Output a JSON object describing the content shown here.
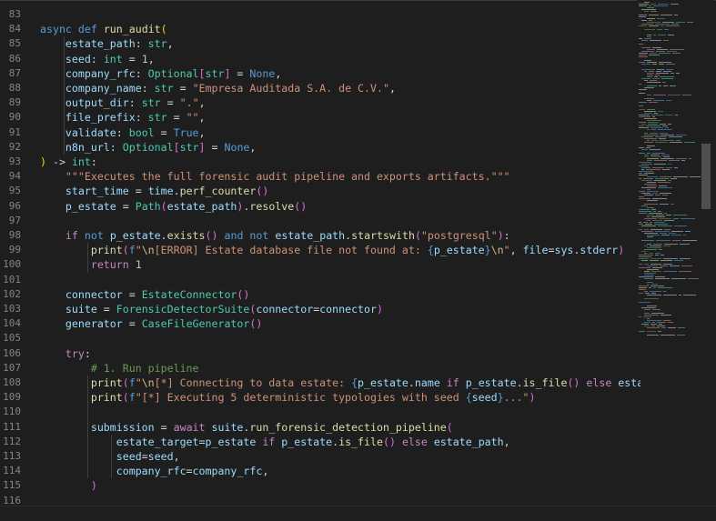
{
  "line_numbers": [
    "83",
    "84",
    "85",
    "86",
    "87",
    "88",
    "89",
    "90",
    "91",
    "92",
    "93",
    "94",
    "95",
    "96",
    "97",
    "98",
    "99",
    "100",
    "101",
    "102",
    "103",
    "104",
    "105",
    "106",
    "107",
    "108",
    "109",
    "110",
    "111",
    "112",
    "113",
    "114",
    "115",
    "116"
  ],
  "code": [
    [],
    [
      [
        "kw",
        "async"
      ],
      [
        "pn",
        " "
      ],
      [
        "kw",
        "def"
      ],
      [
        "pn",
        " "
      ],
      [
        "fn",
        "run_audit"
      ],
      [
        "par",
        "("
      ]
    ],
    [
      [
        "pn",
        "    "
      ],
      [
        "var",
        "estate_path"
      ],
      [
        "pn",
        ": "
      ],
      [
        "cls",
        "str"
      ],
      [
        "pn",
        ","
      ]
    ],
    [
      [
        "pn",
        "    "
      ],
      [
        "var",
        "seed"
      ],
      [
        "pn",
        ": "
      ],
      [
        "cls",
        "int"
      ],
      [
        "op",
        " = "
      ],
      [
        "num",
        "1"
      ],
      [
        "pn",
        ","
      ]
    ],
    [
      [
        "pn",
        "    "
      ],
      [
        "var",
        "company_rfc"
      ],
      [
        "pn",
        ": "
      ],
      [
        "cls",
        "Optional"
      ],
      [
        "br",
        "["
      ],
      [
        "cls",
        "str"
      ],
      [
        "br",
        "]"
      ],
      [
        "op",
        " = "
      ],
      [
        "kw",
        "None"
      ],
      [
        "pn",
        ","
      ]
    ],
    [
      [
        "pn",
        "    "
      ],
      [
        "var",
        "company_name"
      ],
      [
        "pn",
        ": "
      ],
      [
        "cls",
        "str"
      ],
      [
        "op",
        " = "
      ],
      [
        "str",
        "\"Empresa Auditada S.A. de C.V.\""
      ],
      [
        "pn",
        ","
      ]
    ],
    [
      [
        "pn",
        "    "
      ],
      [
        "var",
        "output_dir"
      ],
      [
        "pn",
        ": "
      ],
      [
        "cls",
        "str"
      ],
      [
        "op",
        " = "
      ],
      [
        "str",
        "\".\""
      ],
      [
        "pn",
        ","
      ]
    ],
    [
      [
        "pn",
        "    "
      ],
      [
        "var",
        "file_prefix"
      ],
      [
        "pn",
        ": "
      ],
      [
        "cls",
        "str"
      ],
      [
        "op",
        " = "
      ],
      [
        "str",
        "\"\""
      ],
      [
        "pn",
        ","
      ]
    ],
    [
      [
        "pn",
        "    "
      ],
      [
        "var",
        "validate"
      ],
      [
        "pn",
        ": "
      ],
      [
        "cls",
        "bool"
      ],
      [
        "op",
        " = "
      ],
      [
        "kw",
        "True"
      ],
      [
        "pn",
        ","
      ]
    ],
    [
      [
        "pn",
        "    "
      ],
      [
        "var",
        "n8n_url"
      ],
      [
        "pn",
        ": "
      ],
      [
        "cls",
        "Optional"
      ],
      [
        "br",
        "["
      ],
      [
        "cls",
        "str"
      ],
      [
        "br",
        "]"
      ],
      [
        "op",
        " = "
      ],
      [
        "kw",
        "None"
      ],
      [
        "pn",
        ","
      ]
    ],
    [
      [
        "par",
        ")"
      ],
      [
        "op",
        " -> "
      ],
      [
        "cls",
        "int"
      ],
      [
        "pn",
        ":"
      ]
    ],
    [
      [
        "pn",
        "    "
      ],
      [
        "str",
        "\"\"\"Executes the full forensic audit pipeline and exports artifacts.\"\"\""
      ]
    ],
    [
      [
        "pn",
        "    "
      ],
      [
        "var",
        "start_time"
      ],
      [
        "op",
        " = "
      ],
      [
        "var",
        "time"
      ],
      [
        "pn",
        "."
      ],
      [
        "fn",
        "perf_counter"
      ],
      [
        "br",
        "()"
      ]
    ],
    [
      [
        "pn",
        "    "
      ],
      [
        "var",
        "p_estate"
      ],
      [
        "op",
        " = "
      ],
      [
        "cls",
        "Path"
      ],
      [
        "br",
        "("
      ],
      [
        "var",
        "estate_path"
      ],
      [
        "br",
        ")"
      ],
      [
        "pn",
        "."
      ],
      [
        "fn",
        "resolve"
      ],
      [
        "br",
        "()"
      ]
    ],
    [],
    [
      [
        "pn",
        "    "
      ],
      [
        "ctl",
        "if"
      ],
      [
        "pn",
        " "
      ],
      [
        "kw",
        "not"
      ],
      [
        "pn",
        " "
      ],
      [
        "var",
        "p_estate"
      ],
      [
        "pn",
        "."
      ],
      [
        "fn",
        "exists"
      ],
      [
        "br",
        "()"
      ],
      [
        "pn",
        " "
      ],
      [
        "kw",
        "and"
      ],
      [
        "pn",
        " "
      ],
      [
        "kw",
        "not"
      ],
      [
        "pn",
        " "
      ],
      [
        "var",
        "estate_path"
      ],
      [
        "pn",
        "."
      ],
      [
        "fn",
        "startswith"
      ],
      [
        "br",
        "("
      ],
      [
        "str",
        "\"postgresql\""
      ],
      [
        "br",
        ")"
      ],
      [
        "pn",
        ":"
      ]
    ],
    [
      [
        "pn",
        "        "
      ],
      [
        "fn",
        "print"
      ],
      [
        "br",
        "("
      ],
      [
        "kw",
        "f"
      ],
      [
        "str",
        "\""
      ],
      [
        "esc",
        "\\n"
      ],
      [
        "str",
        "[ERROR] Estate database file not found at: "
      ],
      [
        "kw",
        "{"
      ],
      [
        "var",
        "p_estate"
      ],
      [
        "kw",
        "}"
      ],
      [
        "esc",
        "\\n"
      ],
      [
        "str",
        "\""
      ],
      [
        "pn",
        ", "
      ],
      [
        "var",
        "file"
      ],
      [
        "op",
        "="
      ],
      [
        "var",
        "sys"
      ],
      [
        "pn",
        "."
      ],
      [
        "var",
        "stderr"
      ],
      [
        "br",
        ")"
      ]
    ],
    [
      [
        "pn",
        "        "
      ],
      [
        "ctl",
        "return"
      ],
      [
        "pn",
        " "
      ],
      [
        "num",
        "1"
      ]
    ],
    [],
    [
      [
        "pn",
        "    "
      ],
      [
        "var",
        "connector"
      ],
      [
        "op",
        " = "
      ],
      [
        "cls",
        "EstateConnector"
      ],
      [
        "br",
        "()"
      ]
    ],
    [
      [
        "pn",
        "    "
      ],
      [
        "var",
        "suite"
      ],
      [
        "op",
        " = "
      ],
      [
        "cls",
        "ForensicDetectorSuite"
      ],
      [
        "br",
        "("
      ],
      [
        "var",
        "connector"
      ],
      [
        "op",
        "="
      ],
      [
        "var",
        "connector"
      ],
      [
        "br",
        ")"
      ]
    ],
    [
      [
        "pn",
        "    "
      ],
      [
        "var",
        "generator"
      ],
      [
        "op",
        " = "
      ],
      [
        "cls",
        "CaseFileGenerator"
      ],
      [
        "br",
        "()"
      ]
    ],
    [],
    [
      [
        "pn",
        "    "
      ],
      [
        "ctl",
        "try"
      ],
      [
        "pn",
        ":"
      ]
    ],
    [
      [
        "pn",
        "        "
      ],
      [
        "cmt",
        "# 1. Run pipeline"
      ]
    ],
    [
      [
        "pn",
        "        "
      ],
      [
        "fn",
        "print"
      ],
      [
        "br",
        "("
      ],
      [
        "kw",
        "f"
      ],
      [
        "str",
        "\""
      ],
      [
        "esc",
        "\\n"
      ],
      [
        "str",
        "[*] Connecting to data estate: "
      ],
      [
        "kw",
        "{"
      ],
      [
        "var",
        "p_estate"
      ],
      [
        "pn",
        "."
      ],
      [
        "var",
        "name"
      ],
      [
        "pn",
        " "
      ],
      [
        "ctl",
        "if"
      ],
      [
        "pn",
        " "
      ],
      [
        "var",
        "p_estate"
      ],
      [
        "pn",
        "."
      ],
      [
        "fn",
        "is_file"
      ],
      [
        "br",
        "()"
      ],
      [
        "pn",
        " "
      ],
      [
        "ctl",
        "else"
      ],
      [
        "pn",
        " "
      ],
      [
        "var",
        "estate_pa"
      ],
      [
        "fade",
        "th}\")"
      ]
    ],
    [
      [
        "pn",
        "        "
      ],
      [
        "fn",
        "print"
      ],
      [
        "br",
        "("
      ],
      [
        "kw",
        "f"
      ],
      [
        "str",
        "\"[*] Executing 5 deterministic typologies with seed "
      ],
      [
        "kw",
        "{"
      ],
      [
        "var",
        "seed"
      ],
      [
        "kw",
        "}"
      ],
      [
        "str",
        "...\""
      ],
      [
        "br",
        ")"
      ]
    ],
    [],
    [
      [
        "pn",
        "        "
      ],
      [
        "var",
        "submission"
      ],
      [
        "op",
        " = "
      ],
      [
        "ctl",
        "await"
      ],
      [
        "pn",
        " "
      ],
      [
        "var",
        "suite"
      ],
      [
        "pn",
        "."
      ],
      [
        "fn",
        "run_forensic_detection_pipeline"
      ],
      [
        "br",
        "("
      ]
    ],
    [
      [
        "pn",
        "            "
      ],
      [
        "var",
        "estate_target"
      ],
      [
        "op",
        "="
      ],
      [
        "var",
        "p_estate"
      ],
      [
        "pn",
        " "
      ],
      [
        "ctl",
        "if"
      ],
      [
        "pn",
        " "
      ],
      [
        "var",
        "p_estate"
      ],
      [
        "pn",
        "."
      ],
      [
        "fn",
        "is_file"
      ],
      [
        "br",
        "()"
      ],
      [
        "pn",
        " "
      ],
      [
        "ctl",
        "else"
      ],
      [
        "pn",
        " "
      ],
      [
        "var",
        "estate_path"
      ],
      [
        "pn",
        ","
      ]
    ],
    [
      [
        "pn",
        "            "
      ],
      [
        "var",
        "seed"
      ],
      [
        "op",
        "="
      ],
      [
        "var",
        "seed"
      ],
      [
        "pn",
        ","
      ]
    ],
    [
      [
        "pn",
        "            "
      ],
      [
        "var",
        "company_rfc"
      ],
      [
        "op",
        "="
      ],
      [
        "var",
        "company_rfc"
      ],
      [
        "pn",
        ","
      ]
    ],
    [
      [
        "pn",
        "        "
      ],
      [
        "br",
        ")"
      ]
    ],
    []
  ]
}
